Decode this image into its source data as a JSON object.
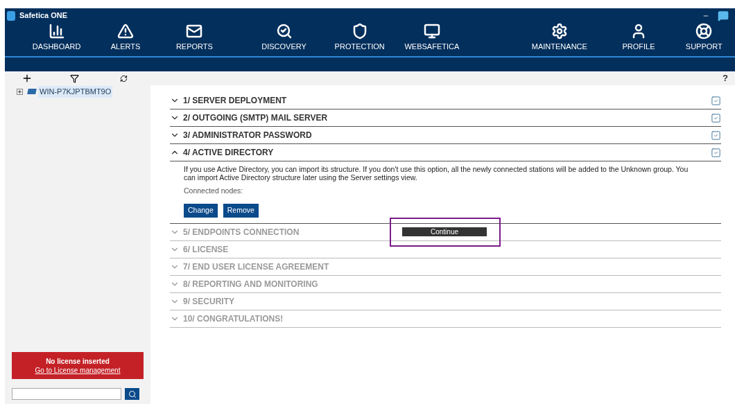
{
  "window": {
    "title": "Safetica ONE"
  },
  "nav": [
    {
      "label": "DASHBOARD",
      "selected": false
    },
    {
      "label": "ALERTS",
      "selected": false
    },
    {
      "label": "REPORTS",
      "selected": false
    },
    {
      "label": "DISCOVERY",
      "selected": false
    },
    {
      "label": "PROTECTION",
      "selected": false
    },
    {
      "label": "WEBSAFETICA",
      "selected": false
    },
    {
      "label": "MAINTENANCE",
      "selected": false
    },
    {
      "label": "PROFILE",
      "selected": false
    },
    {
      "label": "SUPPORT",
      "selected": false
    }
  ],
  "help": "?",
  "tree": [
    {
      "label": "WIN-P7KJPTBMT9O",
      "expanded": false,
      "selected": true
    }
  ],
  "license": {
    "title": "No license inserted",
    "link": "Go to License management"
  },
  "sections": [
    {
      "title": "1/ SERVER DEPLOYMENT",
      "expanded": false,
      "checked": true,
      "disabled": false
    },
    {
      "title": "2/ OUTGOING (SMTP) MAIL SERVER",
      "expanded": false,
      "checked": true,
      "disabled": false
    },
    {
      "title": "3/ ADMINISTRATOR PASSWORD",
      "expanded": false,
      "checked": true,
      "disabled": false
    },
    {
      "title": "4/ ACTIVE DIRECTORY",
      "expanded": true,
      "checked": true,
      "disabled": false,
      "body": {
        "text": "If you use Active Directory, you can import its structure. If you don't use this option, all the newly connected stations will be added to the Unknown group. You can import Active Directory structure later using the Server settings view.",
        "nodes_label": "Connected nodes:",
        "buttons": [
          "Change",
          "Remove"
        ],
        "tooltip": "Continue"
      }
    },
    {
      "title": "5/ ENDPOINTS CONNECTION",
      "expanded": false,
      "checked": false,
      "disabled": true
    },
    {
      "title": "6/ LICENSE",
      "expanded": false,
      "checked": false,
      "disabled": true
    },
    {
      "title": "7/ END USER LICENSE AGREEMENT",
      "expanded": false,
      "checked": false,
      "disabled": true
    },
    {
      "title": "8/ REPORTING AND MONITORING",
      "expanded": false,
      "checked": false,
      "disabled": true
    },
    {
      "title": "9/ SECURITY",
      "expanded": false,
      "checked": false,
      "disabled": true
    },
    {
      "title": "10/ CONGRATULATIONS!",
      "expanded": false,
      "checked": false,
      "disabled": true
    }
  ]
}
